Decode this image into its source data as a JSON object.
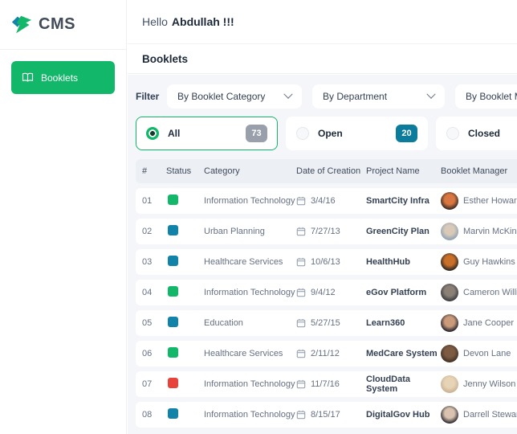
{
  "app": {
    "logo_text": "CMS"
  },
  "sidebar": {
    "items": [
      {
        "label": "Booklets"
      }
    ]
  },
  "topbar": {
    "greeting_prefix": "Hello",
    "greeting_name": "Abdullah !!!"
  },
  "page": {
    "title": "Booklets"
  },
  "filters": {
    "label": "Filter",
    "dropdowns": [
      {
        "value": "By Booklet Category"
      },
      {
        "value": "By Department"
      },
      {
        "value": "By Booklet Manager"
      }
    ]
  },
  "tabs": [
    {
      "label": "All",
      "count": "73",
      "selected": true,
      "badge_color": "#9AA0AB"
    },
    {
      "label": "Open",
      "count": "20",
      "selected": false,
      "badge_color": "#0B7C9C"
    },
    {
      "label": "Closed",
      "selected": false
    }
  ],
  "table": {
    "columns": [
      "#",
      "Status",
      "Category",
      "Date of Creation",
      "Project Name",
      "Booklet Manager"
    ],
    "rows": [
      {
        "num": "01",
        "status_color": "#12B76A",
        "category": "Information Technology",
        "date": "3/4/16",
        "project": "SmartCity Infra",
        "manager": "Esther Howard",
        "avatar": [
          "#3a2a22",
          "#d97742"
        ]
      },
      {
        "num": "02",
        "status_color": "#1182A8",
        "category": "Urban Planning",
        "date": "7/27/13",
        "project": "GreenCity Plan",
        "manager": "Marvin McKinney",
        "avatar": [
          "#8fa3b5",
          "#d8c9b8"
        ]
      },
      {
        "num": "03",
        "status_color": "#1182A8",
        "category": "Healthcare Services",
        "date": "10/6/13",
        "project": "HealthHub",
        "manager": "Guy Hawkins",
        "avatar": [
          "#2e2620",
          "#c86f2a"
        ]
      },
      {
        "num": "04",
        "status_color": "#12B76A",
        "category": "Information Technology",
        "date": "9/4/12",
        "project": "eGov Platform",
        "manager": "Cameron Williamson",
        "avatar": [
          "#3c3c40",
          "#8a8076"
        ]
      },
      {
        "num": "05",
        "status_color": "#1182A8",
        "category": "Education",
        "date": "5/27/15",
        "project": "Learn360",
        "manager": "Jane Cooper",
        "avatar": [
          "#2b2530",
          "#c99b7a"
        ]
      },
      {
        "num": "06",
        "status_color": "#12B76A",
        "category": "Healthcare Services",
        "date": "2/11/12",
        "project": "MedCare System",
        "manager": "Devon Lane",
        "avatar": [
          "#433227",
          "#7d5b43"
        ]
      },
      {
        "num": "07",
        "status_color": "#E8433A",
        "category": "Information Technology",
        "date": "11/7/16",
        "project": "CloudData System",
        "manager": "Jenny Wilson",
        "avatar": [
          "#c9b396",
          "#e7d3b5"
        ]
      },
      {
        "num": "08",
        "status_color": "#1182A8",
        "category": "Information Technology",
        "date": "8/15/17",
        "project": "DigitalGov Hub",
        "manager": "Darrell Steward",
        "avatar": [
          "#332e35",
          "#d9c2b0"
        ]
      }
    ]
  },
  "colors": {
    "accent_green": "#12B76A",
    "status_blue": "#1182A8",
    "status_red": "#E8433A",
    "logo_teal": "#1386A8",
    "content_bg": "#F5F6FA",
    "table_header_bg": "#ECEFF4"
  }
}
